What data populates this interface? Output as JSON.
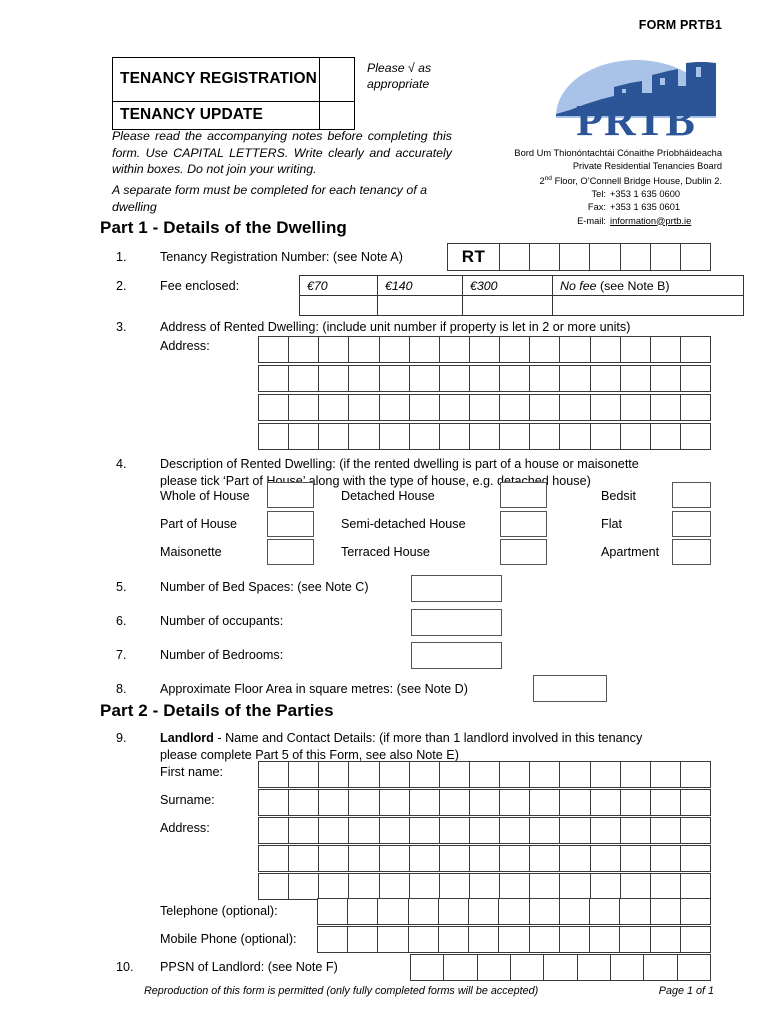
{
  "header": {
    "form_code": "FORM PRTB1",
    "tenancy_registration": "TENANCY REGISTRATION",
    "tenancy_update": "TENANCY UPDATE",
    "tick_note": "Please √ as appropriate",
    "logo_word": "PRTB",
    "intro_paragraph_1": "Please read the accompanying notes before completing this form.  Use CAPITAL LETTERS.  Write clearly and accurately within boxes.  Do not join your writing.",
    "intro_paragraph_2": "A separate form must be completed for each tenancy of a dwelling"
  },
  "contact": {
    "irish_name": "Bord Um Thionóntachtái Cónaithe Príobháideacha",
    "english_name": "Private Residential Tenancies Board",
    "address_line": "Floor, O’Connell Bridge House, Dublin 2.",
    "address_prefix": "2",
    "address_ordinal": "nd",
    "tel_label": "Tel:",
    "tel_value": "+353 1 635 0600",
    "fax_label": "Fax:",
    "fax_value": "+353 1 635 0601",
    "email_label": "E-mail:",
    "email_value": "information@prtb.ie"
  },
  "part1": {
    "title": "Part 1 - Details of the Dwelling",
    "q1": {
      "num": "1.",
      "text": "Tenancy Registration Number: (see Note A)",
      "prefix": "RT",
      "cell_count": 7
    },
    "q2": {
      "num": "2.",
      "text": "Fee enclosed:",
      "options": [
        "€70",
        "€140",
        "€300"
      ],
      "no_fee_italic": "No fee",
      "no_fee_rest": " (see Note B)"
    },
    "q3": {
      "num": "3.",
      "text": "Address of Rented Dwelling: (include unit number if property is let in 2 or more units)",
      "label": "Address:",
      "rows": 4,
      "cells_per_row": 15
    },
    "q4": {
      "num": "4.",
      "text_line1": "Description of Rented Dwelling: (if the rented dwelling is part of a house or maisonette",
      "text_line2": "please tick ‘Part of House’ along with the type of house, e.g. detached house)",
      "col1": [
        "Whole of House",
        "Part of House",
        "Maisonette"
      ],
      "col2": [
        "Detached House",
        "Semi-detached House",
        "Terraced House"
      ],
      "col3": [
        "Bedsit",
        "Flat",
        "Apartment"
      ]
    },
    "q5": {
      "num": "5.",
      "text": "Number of Bed Spaces: (see Note C)"
    },
    "q6": {
      "num": "6.",
      "text": "Number of occupants:"
    },
    "q7": {
      "num": "7.",
      "text": "Number of Bedrooms:"
    },
    "q8": {
      "num": "8.",
      "text": "Approximate Floor Area in square metres: (see Note D)"
    }
  },
  "part2": {
    "title": "Part 2 - Details of the Parties",
    "q9": {
      "num": "9.",
      "text_bold": "Landlord",
      "text_line1_rest": " - Name and Contact Details: (if more than 1 landlord involved in this tenancy",
      "text_line2": "please complete Part 5 of this Form, see also Note E)",
      "first_name_label": "First name:",
      "surname_label": "Surname:",
      "address_label": "Address:",
      "telephone_label": "Telephone (optional):",
      "mobile_label": "Mobile Phone (optional):",
      "name_cells": 15,
      "address_rows": 3,
      "phone_cells": 13
    },
    "q10": {
      "num": "10.",
      "text": "PPSN of Landlord: (see Note F)",
      "cells": 9
    }
  },
  "footer": {
    "note": "Reproduction of this form is permitted  (only fully completed forms will be accepted)",
    "page": "Page 1 of 1"
  },
  "colors": {
    "logo_dark_blue": "#2b5596",
    "logo_light_blue": "#a8c2e8",
    "border": "#3a3a3a"
  }
}
